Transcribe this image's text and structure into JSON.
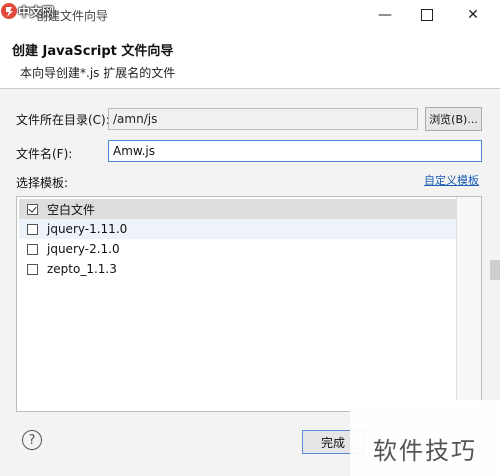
{
  "logo": {
    "text": "中文网"
  },
  "window": {
    "title": "创建文件向导",
    "controls": {
      "minimize": "—",
      "close": "✕"
    }
  },
  "header": {
    "title": "创建 JavaScript 文件向导",
    "description": "本向导创建*.js 扩展名的文件"
  },
  "form": {
    "dir_label": "文件所在目录(C):",
    "dir_value": "/amn/js",
    "browse_label": "浏览(B)...",
    "file_label": "文件名(F):",
    "file_value": "Amw.js",
    "template_label": "选择模板:",
    "custom_template_link": "自定义模板"
  },
  "templates": [
    {
      "label": "空白文件",
      "checked": true
    },
    {
      "label": "jquery-1.11.0",
      "checked": false
    },
    {
      "label": "jquery-2.1.0",
      "checked": false
    },
    {
      "label": "zepto_1.1.3",
      "checked": false
    }
  ],
  "footer": {
    "help_symbol": "?",
    "finish_label": "完成"
  },
  "watermark": {
    "text": "软件技巧"
  },
  "colors": {
    "accent": "#4a8ad8",
    "link": "#1a5fb4",
    "body_bg": "#f3f3f3"
  }
}
